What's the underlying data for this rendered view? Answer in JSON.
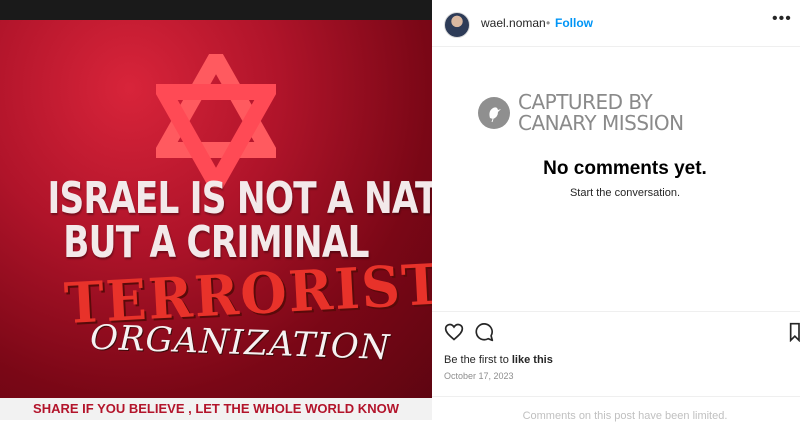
{
  "post": {
    "image": {
      "headline_line1": "ISRAEL IS NOT A NATION",
      "headline_line2": "BUT A CRIMINAL",
      "graffiti_word1": "TERRORIST",
      "graffiti_word2": "ORGANIZATION",
      "share_text": "SHARE IF YOU BELIEVE , LET THE WHOLE WORLD KNOW",
      "symbol_icon": "star-of-david-icon"
    }
  },
  "header": {
    "username": "wael.noman",
    "separator": "•",
    "follow_label": "Follow",
    "more_icon": "more-horizontal-icon"
  },
  "watermark": {
    "line1": "CAPTURED BY",
    "line2": "CANARY MISSION",
    "logo_icon": "canary-bird-icon"
  },
  "comments": {
    "empty_title": "No comments yet.",
    "empty_subtitle": "Start the conversation."
  },
  "actions": {
    "icons": [
      "heart-icon",
      "comment-icon",
      "bookmark-icon"
    ],
    "likes_prefix": "Be the first to",
    "likes_link": "like this",
    "date": "October 17, 2023",
    "limited_notice": "Comments on this post have been limited."
  },
  "colors": {
    "poster_red": "#b0142a",
    "graffiti_red": "#e8322a",
    "follow_blue": "#0095f6",
    "watermark_gray": "#8a8a8a"
  }
}
